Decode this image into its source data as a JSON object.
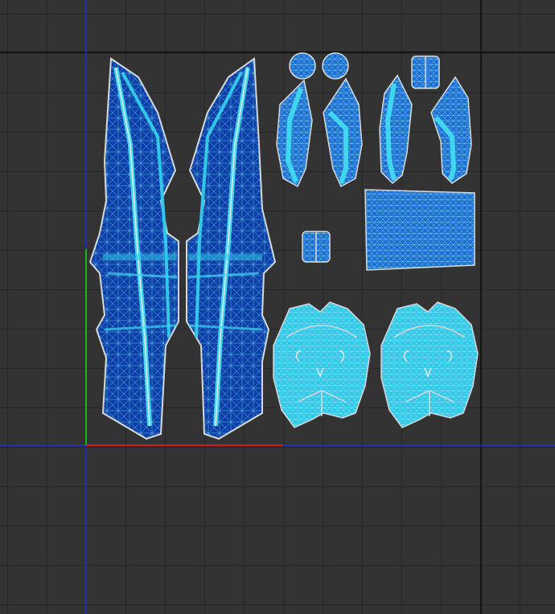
{
  "editor": {
    "view": "uv-editor-viewport",
    "grid": "on"
  },
  "colors": {
    "background": "#333333",
    "grid_minor": "#272727",
    "grid_major": "#1b1b1b",
    "uv_border_black": "#000000",
    "axis_blue": "#1a2fcc",
    "axis_red": "#c81e1e",
    "axis_green": "#1fb31f",
    "island_fill_dark": "#0d3fa8",
    "island_fill_mid": "#1a6fd0",
    "island_fill_light": "#31c8e8",
    "island_fill_cyan": "#3fd6ef",
    "wire": "#7fe9ff",
    "seam": "#d8d8d8"
  },
  "islands": [
    {
      "id": "blade-left"
    },
    {
      "id": "blade-right"
    },
    {
      "id": "disc-left"
    },
    {
      "id": "disc-right"
    },
    {
      "id": "wing-a"
    },
    {
      "id": "wing-b"
    },
    {
      "id": "wing-c"
    },
    {
      "id": "wing-d"
    },
    {
      "id": "small-cap-top"
    },
    {
      "id": "small-cap-mid"
    },
    {
      "id": "square-patch"
    },
    {
      "id": "skull-left"
    },
    {
      "id": "skull-right"
    }
  ]
}
